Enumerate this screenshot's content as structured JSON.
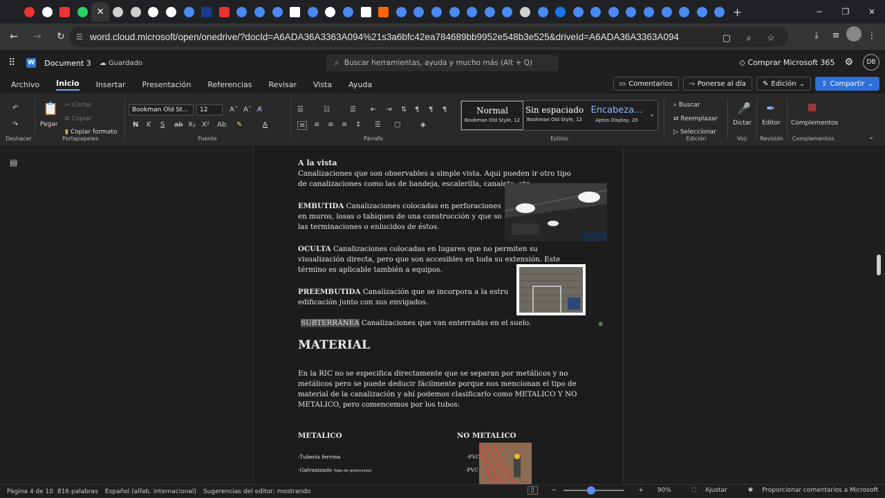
{
  "browser": {
    "url": "word.cloud.microsoft/open/onedrive/?docId=A6ADA36A3363A094%21s3a6bfc42ea784689bb9952e548b3e525&driveId=A6ADA36A3363A094",
    "tab_close_glyph": "✕",
    "new_tab_glyph": "+"
  },
  "app": {
    "doc_title": "Document 3",
    "saved_status": "Guardado",
    "search_placeholder": "Buscar herramientas, ayuda y mucho más (Alt + Q)",
    "buy_label": "Comprar Microsoft 365",
    "avatar_initials": "DB"
  },
  "menu": {
    "items": [
      "Archivo",
      "Inicio",
      "Insertar",
      "Presentación",
      "Referencias",
      "Revisar",
      "Vista",
      "Ayuda"
    ],
    "comments": "Comentarios",
    "catchup": "Ponerse al día",
    "editing": "Edición",
    "share": "Compartir"
  },
  "ribbon": {
    "undo_group": "Deshacer",
    "paste": "Pegar",
    "cut": "Cortar",
    "copy": "Copiar",
    "format_painter": "Copiar formato",
    "clipboard_group": "Portapapeles",
    "font_name": "Bookman Old St...",
    "font_size": "12",
    "font_group": "Fuente",
    "paragraph_group": "Párrafo",
    "styles": [
      {
        "name": "Normal",
        "sub": "Bookman Old Style, 12"
      },
      {
        "name": "Sin espaciado",
        "sub": "Bookman Old Style, 12"
      },
      {
        "name": "Encabeza...",
        "sub": "Aptos Display, 20"
      }
    ],
    "styles_group": "Estilos",
    "find": "Buscar",
    "replace": "Reemplazar",
    "select": "Seleccionar",
    "editing_group": "Edición",
    "dictate": "Dictar",
    "voice_group": "Voz",
    "editor": "Editor",
    "review_group": "Revisión",
    "addins": "Complementos",
    "addins_group": "Complementos"
  },
  "document": {
    "vista_title": "A la vista",
    "vista_l1": "Canalizaciones que son observables a simple vista. Aqui pueden ir otro tipo",
    "vista_l2": "de canalizaciones como las de bandeja, escalerilla, canaleta, etc.",
    "embutida_title": "EMBUTIDA",
    "embutida_l1": " Canalizaciones colocadas en perforaciones",
    "embutida_l2": "en muros, losas o tabiques de una construcción y que so",
    "embutida_l3": "las terminaciones o enlucidos de éstos.",
    "oculta_title": "OCULTA",
    "oculta_l1": " Canalizaciones colocadas en lugares que no permiten su",
    "oculta_l2": "visualización directa, pero que son accesibles en toda su extensión. Este",
    "oculta_l3": "término es aplicable también a equipos.",
    "preembutida_title": "PREEMBUTIDA",
    "preembutida_l1": " Canalización que se incorpora a la estru",
    "preembutida_l2": "edificación junto con sus envigados.",
    "subterranea_title": "SUBTERRÁNEA",
    "subterranea_text": " Canalizaciones que van enterradas en el suelo.",
    "material_heading": "MATERIAL",
    "ric_l1": "En la RIC no se especifica directamente que se separan por metálicos y no",
    "ric_l2": "metálicos pero se puede deducir fácilmente porque nos mencionan el tipo de",
    "ric_l3": "material de la canalización y ahí podemos clasificarlo como METALICO Y NO",
    "ric_l4": "METALICO, pero comencemos por  los tubos:",
    "metalico_heading": "METALICO",
    "no_metalico_heading": "NO METALICO",
    "met_item1": "-Tubería ferrosa",
    "met_item2": "-Galvanizado",
    "met_item2_note": "(tipo de protección)",
    "nomet_item1": "-PVC",
    "nomet_item2": "-PVC"
  },
  "status": {
    "page": "Página 4 de 10",
    "words": "816 palabras",
    "language": "Español (alfab. internacional)",
    "editor_suggestions": "Sugerencias del editor: mostrando",
    "zoom": "90%",
    "fit": "Ajustar",
    "feedback": "Proporcionar comentarios a Microsoft"
  }
}
